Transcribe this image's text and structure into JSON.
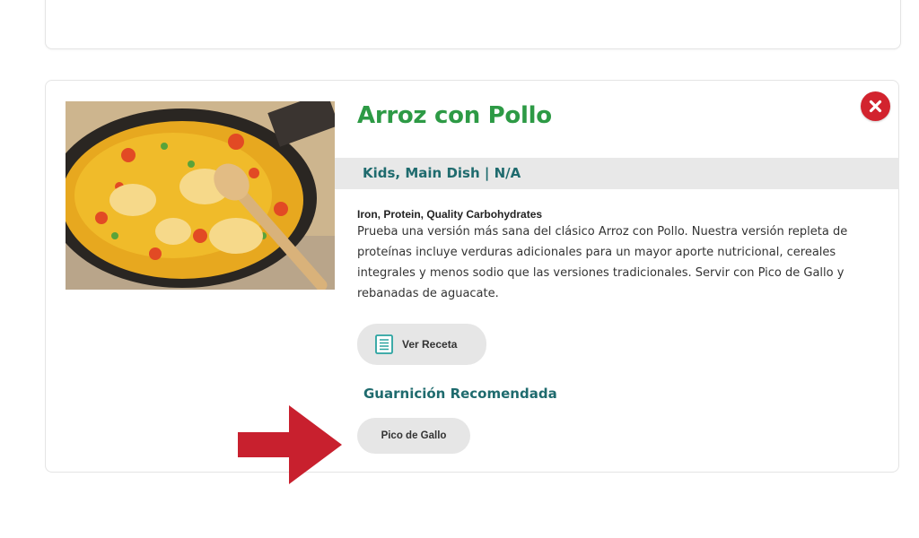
{
  "recipe": {
    "title": "Arroz con Pollo",
    "categories": "Kids, Main Dish | N/A",
    "nutrients": "Iron, Protein, Quality Carbohydrates",
    "description": "Prueba una versión más sana del clásico Arroz con Pollo. Nuestra versión repleta de proteínas incluye verduras adicionales para un mayor aporte nutricional, cereales integrales y menos sodio que las versiones tradicionales. Servir con Pico de Gallo y rebanadas de aguacate.",
    "view_recipe_label": "Ver Receta",
    "view_recipe_icon": "document-icon",
    "side_heading": "Guarnición Recomendada",
    "side_dish_label": "Pico de Gallo",
    "close_icon": "close-icon"
  },
  "colors": {
    "title": "#2d9a45",
    "subheading": "#1f6b6e",
    "close": "#d2232e",
    "annotation_arrow": "#c8202e"
  }
}
